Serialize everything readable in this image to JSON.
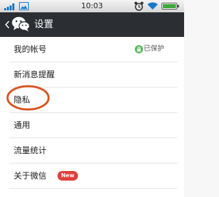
{
  "status_bar": {
    "time": "10:03",
    "icons": [
      "signal-icon",
      "picture-icon",
      "alarm-icon",
      "wifi-icon",
      "battery-icon"
    ],
    "colors": {
      "signal": "#1b78c8",
      "wifi": "#1b78c8",
      "battery": "#3fa83a"
    }
  },
  "nav": {
    "back_icon": "chevron-left-icon",
    "logo_icon": "wechat-logo-icon",
    "title": "设置"
  },
  "settings": {
    "items": [
      {
        "label": "我的帐号",
        "status": "已保护",
        "status_icon": "lock-icon"
      },
      {
        "label": "新消息提醒"
      },
      {
        "label": "隐私",
        "highlighted": true
      },
      {
        "label": "通用"
      },
      {
        "label": "流量统计"
      },
      {
        "label": "关于微信",
        "badge": "New"
      }
    ]
  },
  "colors": {
    "nav_background": "#2b2f33",
    "highlight_ring": "#d9541f",
    "badge": "#e0403a",
    "protect_icon": "#5cb85c"
  }
}
